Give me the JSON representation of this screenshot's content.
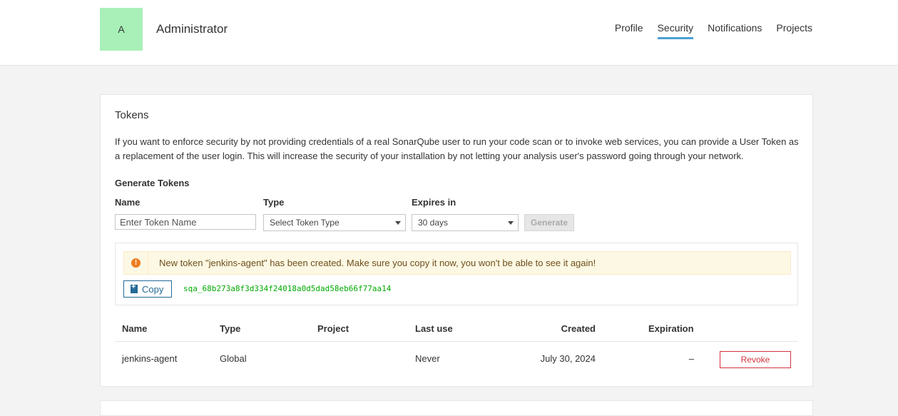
{
  "user": {
    "avatar_letter": "A",
    "name": "Administrator"
  },
  "nav": {
    "items": [
      "Profile",
      "Security",
      "Notifications",
      "Projects"
    ],
    "active": "Security"
  },
  "tokens": {
    "title": "Tokens",
    "description": "If you want to enforce security by not providing credentials of a real SonarQube user to run your code scan or to invoke web services, you can provide a User Token as a replacement of the user login. This will increase the security of your installation by not letting your analysis user's password going through your network.",
    "generate": {
      "title": "Generate Tokens",
      "name_label": "Name",
      "name_placeholder": "Enter Token Name",
      "type_label": "Type",
      "type_value": "Select Token Type",
      "expires_label": "Expires in",
      "expires_value": "30 days",
      "generate_label": "Generate"
    },
    "new_token": {
      "alert_icon": "!",
      "message": "New token \"jenkins-agent\" has been created. Make sure you copy it now, you won't be able to see it again!",
      "copy_label": "Copy",
      "value": "sqa_68b273a8f3d334f24018a0d5dad58eb66f77aa14"
    },
    "table": {
      "headers": [
        "Name",
        "Type",
        "Project",
        "Last use",
        "Created",
        "Expiration"
      ],
      "rows": [
        {
          "name": "jenkins-agent",
          "type": "Global",
          "project": "",
          "last_use": "Never",
          "created": "July 30, 2024",
          "expiration": "–",
          "action": "Revoke"
        }
      ]
    }
  },
  "colors": {
    "accent": "#4b9fd5",
    "avatar_bg": "#a8f0b8",
    "token_green": "#00aa00",
    "revoke_red": "#d4333f",
    "warning_orange": "#ed7d20"
  }
}
